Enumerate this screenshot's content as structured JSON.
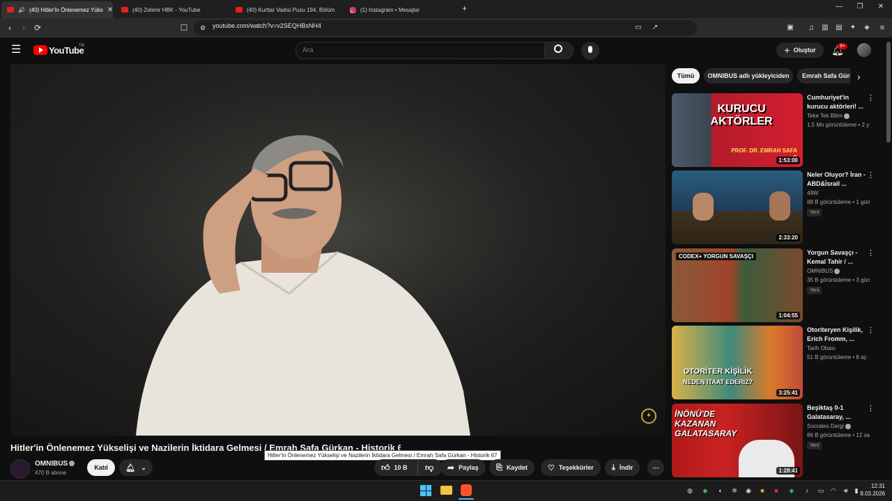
{
  "browser": {
    "tabs": [
      {
        "title": "(40) Hitler'in Önlenemez Yüks",
        "active": true
      },
      {
        "title": "(40) Zelimir HBK - YouTube",
        "active": false
      },
      {
        "title": "(40) Kurtlar Vadisi Pusu 194. Bölüm",
        "active": false
      },
      {
        "title": "(1) Instagram • Mesajlar",
        "active": false
      }
    ],
    "new_tab": "+",
    "url": "youtube.com/watch?v=v2SEQHBsNH4"
  },
  "youtube": {
    "logo_text": "YouTube",
    "region": "TR",
    "search_placeholder": "Ara",
    "create_label": "Oluştur",
    "notif_badge": "9+",
    "chips": [
      "Tümü",
      "OMNIBUS adlı yükleyiciden",
      "Emrah Safa Gürkan"
    ]
  },
  "video": {
    "title": "Hitler'in Önlenemez Yükselişi ve Nazilerin İktidara Gelmesi / Emrah Safa Gürkan - Historik 67",
    "tooltip": "Hitler'in Önlenemez Yükselişi ve Nazilerin İktidara Gelmesi / Emrah Safa Gürkan - Historik 67",
    "channel": "OMNIBUS",
    "subscribers": "470 B abone",
    "join_label": "Katıl",
    "likes": "10 B",
    "share_label": "Paylaş",
    "save_label": "Kaydet",
    "thanks_label": "Teşekkürler",
    "download_label": "İndir"
  },
  "recommendations": [
    {
      "title": "Cumhuriyet'in kurucu aktörleri! ...",
      "channel": "Teke Tek Bilim",
      "verified": true,
      "meta": "1,5 Mn görüntüleme • 2 yıl",
      "duration": "1:53:00",
      "thumb_text": "KURUCU AKTÖRLER",
      "thumb_sub": "PROF. DR. EMRAH SAFA G",
      "new": false
    },
    {
      "title": "Neler Oluyor? İran - ABD&İsrail ...",
      "channel": "49W",
      "verified": false,
      "meta": "88 B görüntüleme • 1 gün",
      "duration": "2:33:20",
      "new": true,
      "new_label": "Yeni"
    },
    {
      "title": "Yorgun Savaşçı - Kemal Tahir / ...",
      "channel": "OMNIBUS",
      "verified": true,
      "meta": "35 B görüntüleme • 3 gün",
      "duration": "1:04:55",
      "thumb_text": "CODEX+ YORGUN SAVAŞÇI",
      "new": true,
      "new_label": "Yeni"
    },
    {
      "title": "Otoriteryen Kişilik, Erich Fromm, ...",
      "channel": "Tarih Obası",
      "verified": false,
      "meta": "51 B görüntüleme • 8 ay",
      "duration": "3:25:41",
      "thumb_text": "OTORİTER KİŞİLİK",
      "thumb_sub": "NEDEN İTAAT EDERİZ?",
      "new": false
    },
    {
      "title": "Beşiktaş 0-1 Galatasaray, ...",
      "channel": "Socrates Dergi",
      "verified": true,
      "meta": "86 B görüntüleme • 12 sa",
      "duration": "1:28:41",
      "thumb_text": "İNÖNÜ'DE KAZANAN GALATASARAY",
      "new": true,
      "new_label": "Yeni"
    }
  ],
  "taskbar": {
    "time": "12:31",
    "date": "8.03.2026"
  },
  "colors": {
    "yt_red": "#ff0000",
    "bg": "#0f0f0f",
    "chip": "#272727"
  }
}
